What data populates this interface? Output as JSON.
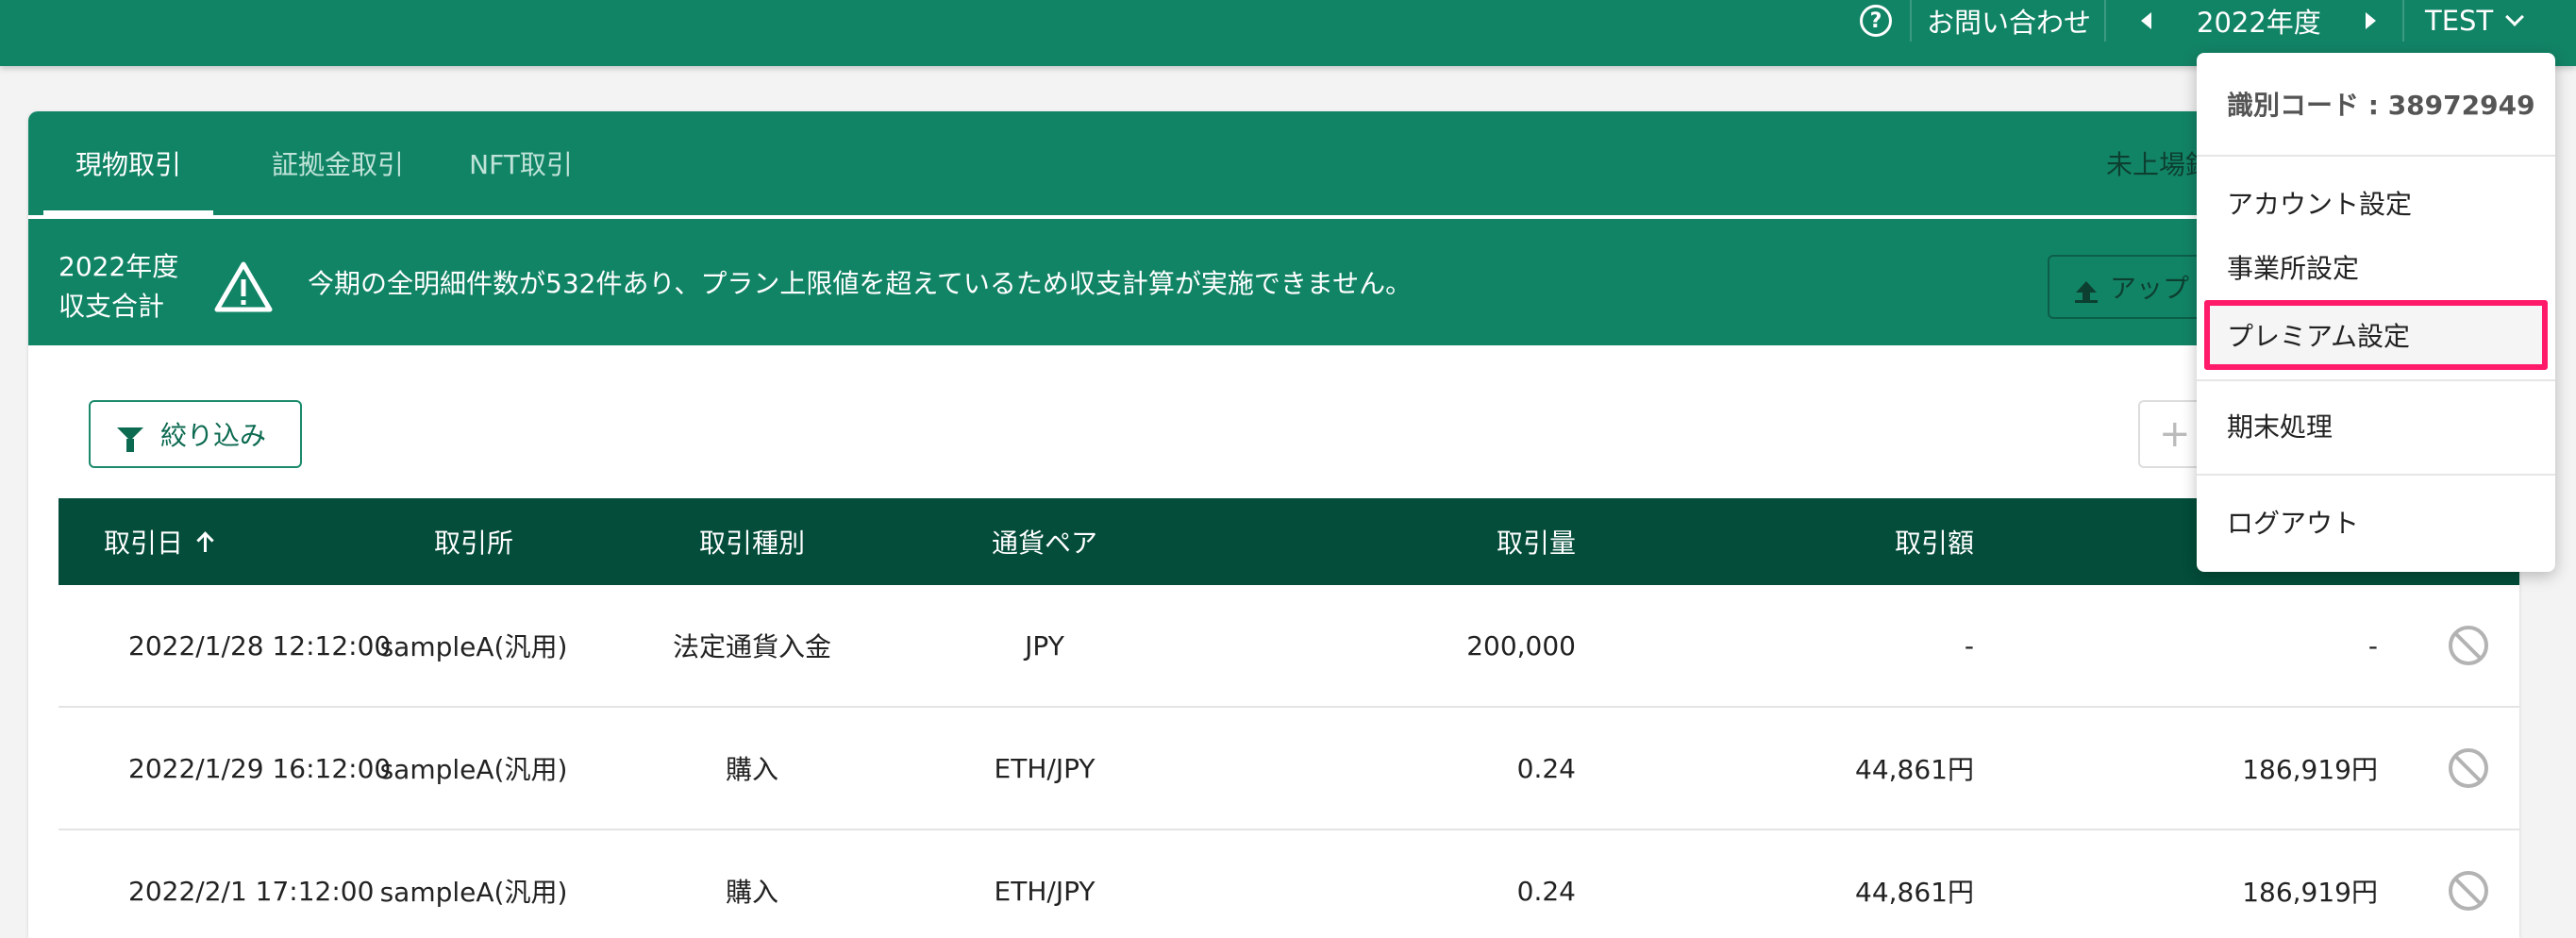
{
  "header": {
    "contact_label": "お問い合わせ",
    "fiscal_year": "2022年度",
    "user_name": "TEST"
  },
  "tabs": [
    {
      "label": "現物取引",
      "active": true
    },
    {
      "label": "証拠金取引",
      "active": false
    },
    {
      "label": "NFT取引",
      "active": false
    }
  ],
  "unlisted_label": "未上場銘",
  "summary": {
    "year_line1": "2022年度",
    "year_line2": "収支合計",
    "alert_message": "今期の全明細件数が532件あり、プラン上限値を超えているため収支計算が実施できません。",
    "upload_label": "アップ"
  },
  "toolbar": {
    "filter_label": "絞り込み",
    "add_label": "+"
  },
  "table": {
    "columns": [
      "取引日",
      "取引所",
      "取引種別",
      "通貨ペア",
      "取引量",
      "取引額"
    ],
    "rows": [
      {
        "date": "2022/1/28 12:12:00",
        "exchange": "sampleA(汎用)",
        "type": "法定通貨入金",
        "pair": "JPY",
        "volume": "200,000",
        "amount": "-",
        "total": "-"
      },
      {
        "date": "2022/1/29 16:12:00",
        "exchange": "sampleA(汎用)",
        "type": "購入",
        "pair": "ETH/JPY",
        "volume": "0.24",
        "amount": "44,861円",
        "total": "186,919円"
      },
      {
        "date": "2022/2/1 17:12:00",
        "exchange": "sampleA(汎用)",
        "type": "購入",
        "pair": "ETH/JPY",
        "volume": "0.24",
        "amount": "44,861円",
        "total": "186,919円"
      }
    ]
  },
  "dropdown": {
    "id_code": "識別コード : 38972949",
    "items": [
      "アカウント設定",
      "事業所設定",
      "プレミアム設定",
      "期末処理",
      "ログアウト"
    ],
    "highlighted": "プレミアム設定"
  },
  "colors": {
    "primary": "#128466",
    "table_header": "#034d3a",
    "highlight_border": "#ff1a6a"
  }
}
